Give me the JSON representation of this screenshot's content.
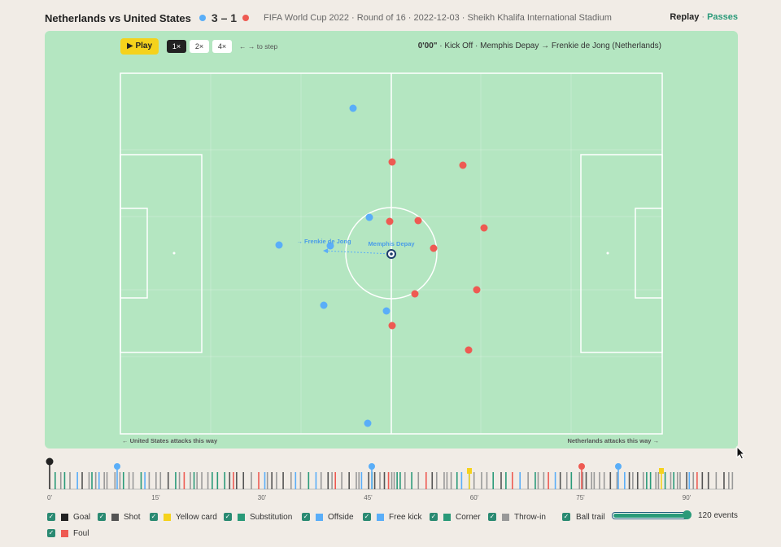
{
  "header": {
    "title": "Netherlands vs United States",
    "score": "3 – 1",
    "meta": "FIFA World Cup 2022 · Round of 16 · 2022-12-03 · Sheikh Khalifa International Stadium",
    "view_replay": "Replay",
    "view_sep": "·",
    "view_passes": "Passes"
  },
  "colors": {
    "home": "#5aaef8",
    "away": "#ee5a52",
    "pitch": "#b4e6c1",
    "accent": "#2a9a79"
  },
  "controls": {
    "play_label": "▶ Play",
    "speeds": [
      "1×",
      "2×",
      "4×"
    ],
    "active_speed": "1×",
    "hint": "← → to step"
  },
  "event": {
    "time": "0'00\"",
    "rest": "· Kick Off · Memphis Depay → Frenkie de Jong (Netherlands)"
  },
  "pitch": {
    "attack_left": "← United States attacks this way",
    "attack_right": "Netherlands attacks this way →",
    "ball_holder_label": "Memphis Depay",
    "pass_target_label": "→ Frenkie de Jong"
  },
  "timeline": {
    "ticks": [
      "0'",
      "15'",
      "30'",
      "45'",
      "60'",
      "75'",
      "90'"
    ],
    "current_minute": 0
  },
  "legend": [
    {
      "label": "Goal",
      "color": "#222222",
      "checked": true
    },
    {
      "label": "Shot",
      "color": "#555555",
      "checked": true
    },
    {
      "label": "Yellow card",
      "color": "#f5d21c",
      "checked": true
    },
    {
      "label": "Substitution",
      "color": "#2a9a79",
      "checked": true
    },
    {
      "label": "Offside",
      "color": "#5aaef8",
      "checked": true
    },
    {
      "label": "Free kick",
      "color": "#5aaef8",
      "checked": true
    },
    {
      "label": "Corner",
      "color": "#2a9a79",
      "checked": true
    },
    {
      "label": "Throw-in",
      "color": "#999999",
      "checked": true
    },
    {
      "label": "Ball trail",
      "checked": true
    },
    {
      "label": "Foul",
      "color": "#ee5a52",
      "checked": true
    }
  ],
  "trail_slider": {
    "value": 1.0
  },
  "events_count": "120 events"
}
